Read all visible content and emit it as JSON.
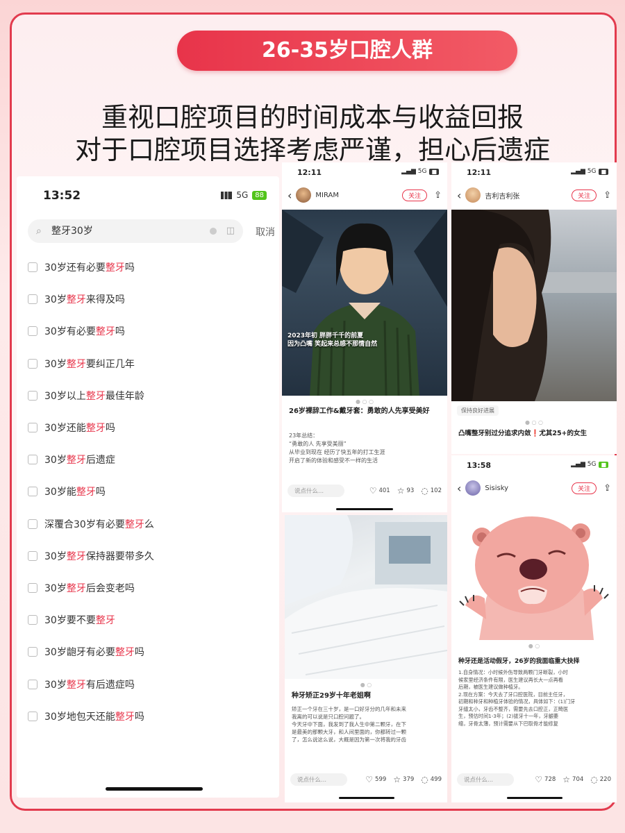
{
  "banner": "26-35岁口腔人群",
  "headline": [
    "重视口腔项目的时间成本与收益回报",
    "对于口腔项目选择考虑严谨，担心后遗症"
  ],
  "phone": {
    "time": "13:52",
    "network": "5G",
    "battery": "88",
    "search_query": "整牙30岁",
    "cancel": "取消",
    "suggestions": [
      {
        "pre": "30岁还有必要",
        "hl": "整牙",
        "post": "吗"
      },
      {
        "pre": "30岁",
        "hl": "整牙",
        "post": "来得及吗"
      },
      {
        "pre": "30岁有必要",
        "hl": "整牙",
        "post": "吗"
      },
      {
        "pre": "30岁",
        "hl": "整牙",
        "post": "要纠正几年"
      },
      {
        "pre": "30岁以上",
        "hl": "整牙",
        "post": "最佳年龄"
      },
      {
        "pre": "30岁还能",
        "hl": "整牙",
        "post": "吗"
      },
      {
        "pre": "30岁",
        "hl": "整牙",
        "post": "后遗症"
      },
      {
        "pre": "30岁能",
        "hl": "整牙",
        "post": "吗"
      },
      {
        "pre": "深覆合30岁有必要",
        "hl": "整牙",
        "post": "么"
      },
      {
        "pre": "30岁",
        "hl": "整牙",
        "post": "保持器要带多久"
      },
      {
        "pre": "30岁",
        "hl": "整牙",
        "post": "后会变老吗"
      },
      {
        "pre": "30岁要不要",
        "hl": "整牙",
        "post": ""
      },
      {
        "pre": "30岁龅牙有必要",
        "hl": "整牙",
        "post": "吗"
      },
      {
        "pre": "30岁",
        "hl": "整牙",
        "post": "有后遗症吗"
      },
      {
        "pre": "30岁地包天还能",
        "hl": "整牙",
        "post": "吗"
      }
    ]
  },
  "post1": {
    "time": "12:11",
    "user": "MIRAM",
    "follow": "关注",
    "overlay": [
      "2023年初 胖胖千千的前夏",
      "因为凸嘴 笑起来总感不那情自然"
    ],
    "title": "26岁裸辞工作&戴牙套：勇敢的人先享受美好",
    "body": [
      "23年总结：",
      "“勇敢的人 先享受美丽”",
      "从毕业到现在 经历了快五年的打工生涯",
      "开启了新的体验和感受不一样的生活"
    ],
    "comment_placeholder": "说点什么...",
    "likes": "401",
    "stars": "93",
    "comments": "102"
  },
  "post2": {
    "time": "12:11",
    "user": "吉利吉利张",
    "follow": "关注",
    "tag": "保持良好进展",
    "title": "凸嘴整牙别过分追求内敛❗尤其25+的女生"
  },
  "post3": {
    "title": "种牙矫正29岁十年老姐啊",
    "body": [
      "矫正一个牙在三十岁，是一口好牙分的几年和未来",
      "我离的可以说是只口腔问题了。",
      "",
      "今天牙中下面，我发到了我人生中第二颗牙，在下",
      "是最美的那颗大牙，和人间里面的，你都转过一颗",
      "了，怎么说这么说，大概是因为第一次将我的牙齿"
    ],
    "comment_placeholder": "说点什么...",
    "likes": "599",
    "stars": "379",
    "comments": "499"
  },
  "post4": {
    "time": "13:58",
    "user": "Sisisky",
    "follow": "关注",
    "title": "种牙还是活动假牙，26岁的我面临重大抉择",
    "body": [
      "1.自身情况：小时候外伤导致两颗门牙断裂，小时",
      "候家里经济条件有限，医生建议再长大一点再看",
      "后期，被医生建议做种植牙。",
      "",
      "2.现在方案：今天去了牙口腔医院，目前主任牙，",
      "初期和种牙和种植牙体验的情况，具体如下：(1)门牙",
      "牙缝太小，牙齿不整齐，需要先去口腔正，正畸医",
      "生，预估时间1-3年；(2)拔牙十一年，牙龈萎",
      "缩，牙骨太薄，预计需要从下巴取骨才能修复"
    ],
    "comment_placeholder": "说点什么...",
    "likes": "728",
    "stars": "704",
    "comments": "220"
  }
}
